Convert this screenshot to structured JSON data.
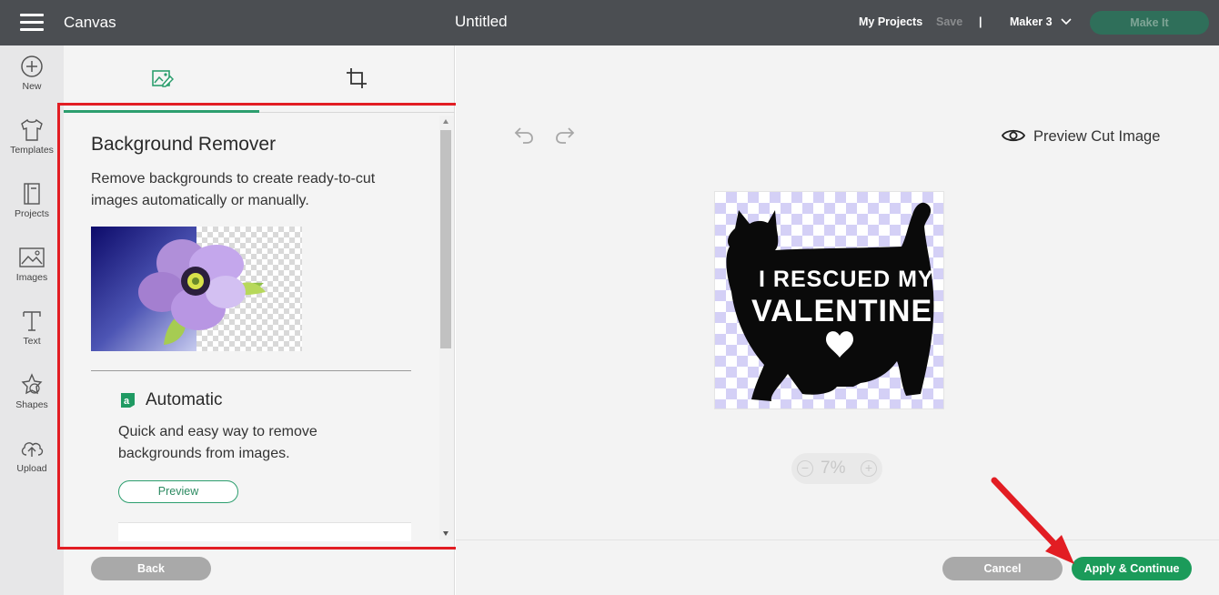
{
  "topbar": {
    "menu_icon": "hamburger-menu-icon",
    "app_title": "Canvas",
    "document_title": "Untitled",
    "my_projects": "My Projects",
    "save": "Save",
    "divider": "|",
    "machine": "Maker 3",
    "machine_chevron_icon": "chevron-down-icon",
    "make_it": "Make It"
  },
  "rail": {
    "items": [
      {
        "label": "New",
        "icon": "plus-circle-icon"
      },
      {
        "label": "Templates",
        "icon": "tshirt-icon"
      },
      {
        "label": "Projects",
        "icon": "notebook-icon"
      },
      {
        "label": "Images",
        "icon": "image-icon"
      },
      {
        "label": "Text",
        "icon": "text-t-icon"
      },
      {
        "label": "Shapes",
        "icon": "shapes-icon"
      },
      {
        "label": "Upload",
        "icon": "cloud-upload-icon"
      }
    ]
  },
  "panel": {
    "tabs": [
      {
        "icon": "image-edit-icon",
        "active": true
      },
      {
        "icon": "crop-icon",
        "active": false
      }
    ],
    "title": "Background Remover",
    "description": "Remove backgrounds to create ready-to-cut images automatically or manually.",
    "automatic": {
      "icon": "automatic-a-icon",
      "title": "Automatic",
      "description": "Quick and easy way to remove backgrounds from images.",
      "preview_button": "Preview"
    },
    "back_button": "Back"
  },
  "canvas": {
    "undo_icon": "undo-icon",
    "redo_icon": "redo-icon",
    "preview_cut_image": "Preview Cut Image",
    "preview_icon": "eye-icon",
    "artwork": {
      "line1": "I RESCUED MY",
      "line2": "VALENTINE"
    },
    "zoom": {
      "value": "7%",
      "minus": "−",
      "plus": "+"
    },
    "cancel_button": "Cancel",
    "apply_button": "Apply & Continue"
  },
  "colors": {
    "topbar": "#4b4e52",
    "accent_green": "#1b9b5a",
    "annotation_red": "#e21d23",
    "checker_lavender": "#d4d0f6"
  }
}
